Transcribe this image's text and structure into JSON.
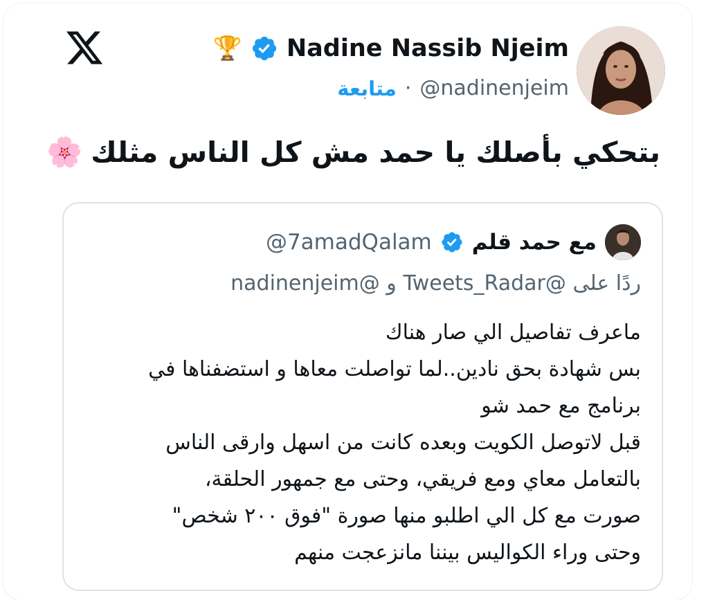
{
  "tweet": {
    "display_name": "Nadine Nassib Njeim",
    "name_emoji": "🏆",
    "handle": "@nadinenjeim",
    "separator": "·",
    "follow_label": "متابعة",
    "text": "بتحكي بأصلك يا حمد مش كل الناس مثلك",
    "text_emoji": "🌸"
  },
  "quoted": {
    "display_name": "مع حمد قلم",
    "handle": "@7amadQalam",
    "reply_prefix": "ردًا على",
    "reply_mention_1": "@Tweets_Radar",
    "reply_and": "و",
    "reply_mention_2": "@nadinenjeim",
    "lines": [
      "ماعرف تفاصيل الي صار هناك",
      "بس شهادة بحق نادين..لما تواصلت معاها و استضفناها في",
      "برنامج مع حمد شو",
      "قبل لاتوصل الكويت وبعده كانت من اسهل وارقى الناس",
      "بالتعامل معاي ومع فريقي، وحتى مع جمهور الحلقة،",
      "صورت مع كل الي اطلبو منها صورة \"فوق ٢٠٠ شخص\"",
      "وحتى وراء الكواليس بيننا مانزعجت منهم"
    ]
  },
  "colors": {
    "accent": "#1d9bf0",
    "secondary_text": "#536471",
    "border": "#dde3e8"
  },
  "icons": {
    "logo": "x-logo",
    "verified": "verified-badge-icon"
  }
}
